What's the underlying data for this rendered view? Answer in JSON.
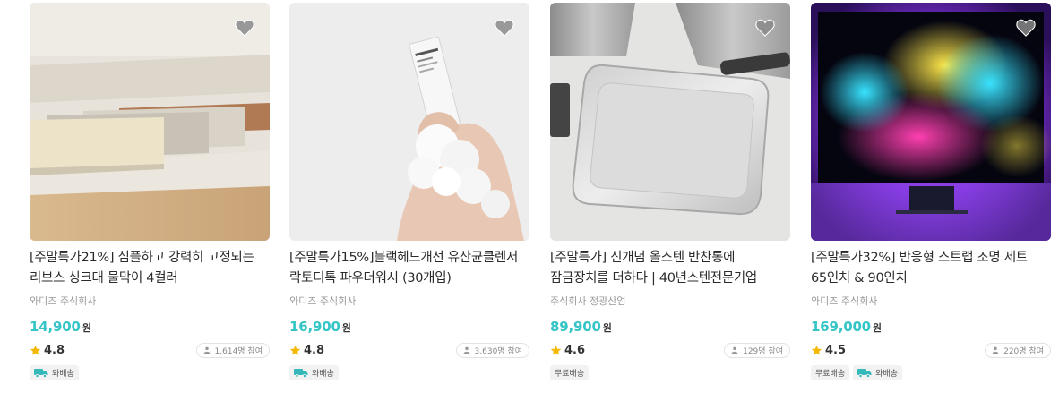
{
  "products": [
    {
      "title": "[주말특가21%] 심플하고 강력히 고정되는 리브스 싱크대 물막이 4컬러",
      "seller": "와디즈 주식회사",
      "price": "14,900",
      "currency": "원",
      "rating": "4.8",
      "participants": "1,614명 참여",
      "tags": [
        {
          "label": "와배송",
          "icon": "truck-icon"
        }
      ],
      "image": "sink-splash-guard-photo"
    },
    {
      "title": "[주말특가15%]블랙헤드개선 유산균클렌저 락토디톡 파우더워시 (30개입)",
      "seller": "와디즈 주식회사",
      "price": "16,900",
      "currency": "원",
      "rating": "4.8",
      "participants": "3,630명 참여",
      "tags": [
        {
          "label": "와배송",
          "icon": "truck-icon"
        }
      ],
      "image": "powder-wash-hand-photo"
    },
    {
      "title": "[주말특가] 신개념 올스텐 반찬통에 잠금장치를 더하다 | 40년스텐전문기업",
      "seller": "주식회사 정광산업",
      "price": "89,900",
      "currency": "원",
      "rating": "4.6",
      "participants": "129명 참여",
      "tags": [
        {
          "label": "무료배송",
          "icon": ""
        }
      ],
      "image": "steel-container-photo"
    },
    {
      "title": "[주말특가32%] 반응형 스트랩 조명 세트 65인치 & 90인치",
      "seller": "와디즈 주식회사",
      "price": "169,000",
      "currency": "원",
      "rating": "4.5",
      "participants": "220명 참여",
      "tags": [
        {
          "label": "무료배송",
          "icon": ""
        },
        {
          "label": "와배송",
          "icon": "truck-icon"
        }
      ],
      "image": "tv-backlight-photo"
    }
  ],
  "colors": {
    "price": "#35c5c7",
    "star": "#f5b800",
    "truck": "#34b8b9"
  }
}
